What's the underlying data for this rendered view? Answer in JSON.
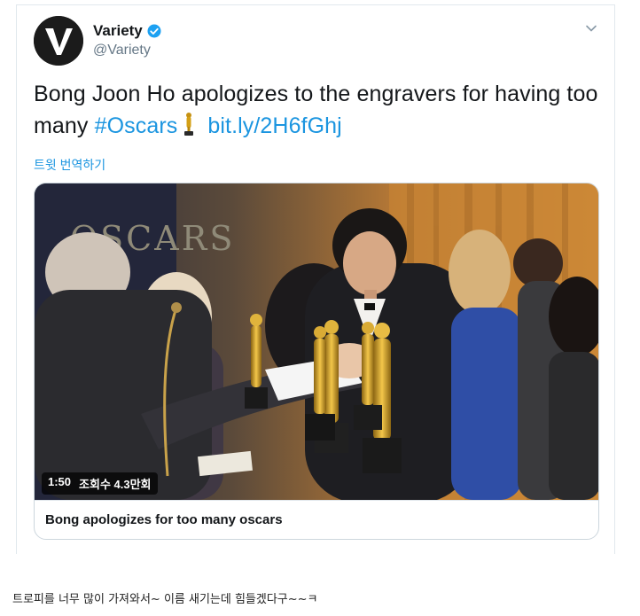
{
  "tweet": {
    "user": {
      "name": "Variety",
      "handle": "@Variety",
      "verified": true,
      "avatar_letter": "V"
    },
    "text_main": "Bong Joon Ho apologizes to the engravers for having too many",
    "hashtag": "#Oscars",
    "link": "bit.ly/2H6fGhj",
    "translate_label": "트윗 번역하기",
    "more_icon": "chevron-down-icon"
  },
  "media": {
    "duration": "1:50",
    "views": "조회수 4.3만회",
    "title": "Bong apologizes for too many oscars",
    "backdrop_text": "OSCARS"
  },
  "caption": "트로피를 너무 많이 가져와서~ 이름 새기는데 힘들겠다구~~ㅋ",
  "colors": {
    "link": "#1b95e0",
    "text": "#14171a",
    "secondary": "#657786",
    "border": "#e1e8ed"
  }
}
